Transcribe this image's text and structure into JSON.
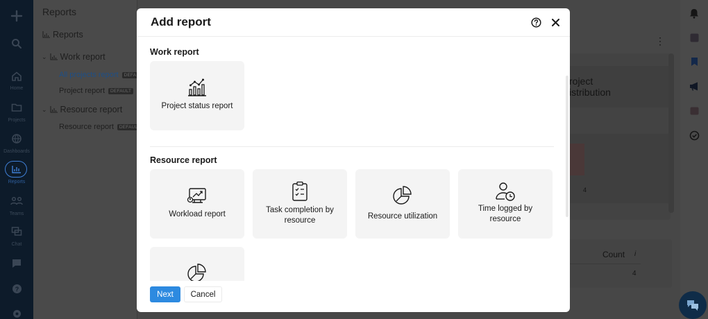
{
  "background": {
    "rail": {
      "items": [
        {
          "icon": "plus-icon"
        },
        {
          "icon": "search-icon"
        },
        {
          "icon": "home-icon",
          "label": "Home"
        },
        {
          "icon": "folder-icon",
          "label": "Projects"
        },
        {
          "icon": "globe-icon",
          "label": "Dashboards"
        },
        {
          "icon": "reports-icon",
          "label": "Reports"
        },
        {
          "icon": "people-icon",
          "label": "Teams"
        },
        {
          "icon": "chat-icon",
          "label": "Chat"
        },
        {
          "icon": "feedback-icon"
        },
        {
          "icon": "help-icon"
        },
        {
          "icon": "settings-icon"
        }
      ]
    },
    "sidepanel": {
      "title": "Reports",
      "reports_label": "Reports",
      "work_report": "Work report",
      "all_projects_report": "All projects report",
      "project_report": "Project report",
      "resource_report": "Resource report",
      "resource_report_item": "Resource report",
      "default_badge": "DEFAULT",
      "default_badge_short": "DEFA"
    },
    "main": {
      "distribution_title_line1": "roject",
      "distribution_title_line2": "istribution",
      "axis_tick": "4",
      "count_header": "Count",
      "count_value": "4",
      "info_mark": "i",
      "kebab": "⋮"
    }
  },
  "modal": {
    "title": "Add report",
    "help_icon": "help-circle-icon",
    "close_icon": "close-icon",
    "sections": [
      {
        "title": "Work report",
        "cards": [
          {
            "label": "Project status report",
            "icon": "bar-line-chart-icon"
          }
        ]
      },
      {
        "title": "Resource report",
        "cards": [
          {
            "label": "Workload report",
            "icon": "workload-monitor-icon"
          },
          {
            "label": "Task completion by resource",
            "icon": "clipboard-checklist-icon"
          },
          {
            "label": "Resource utilization",
            "icon": "pie-chart-icon"
          },
          {
            "label": "Time logged by resource",
            "icon": "user-clock-icon"
          },
          {
            "label": "",
            "icon": "pie-chart-icon"
          }
        ]
      }
    ],
    "next_label": "Next",
    "cancel_label": "Cancel"
  },
  "colors": {
    "accent": "#2d8ae0",
    "rail": "#0d1b2a",
    "card_bg": "#f4f4f4"
  }
}
